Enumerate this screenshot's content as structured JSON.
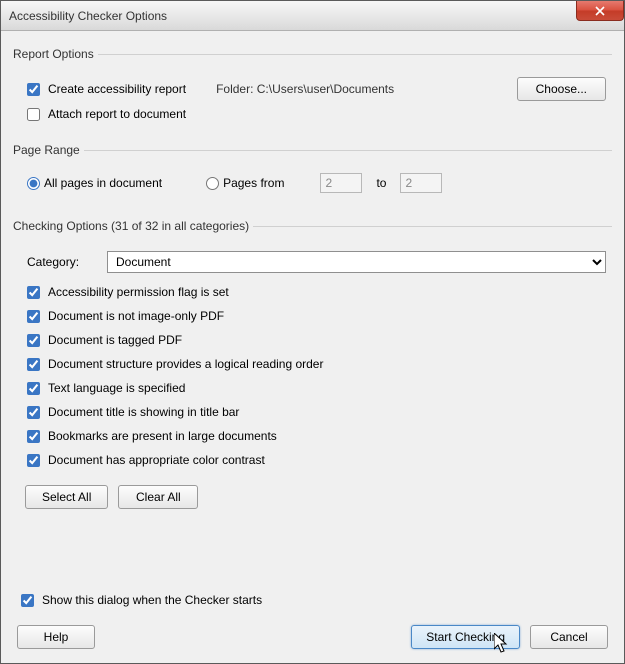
{
  "window": {
    "title": "Accessibility Checker Options"
  },
  "report": {
    "legend": "Report Options",
    "create_label": "Create accessibility report",
    "folder_prefix": "Folder:",
    "folder_path": "C:\\Users\\user\\Documents",
    "choose_label": "Choose...",
    "attach_label": "Attach report to document"
  },
  "page_range": {
    "legend": "Page Range",
    "all_label": "All pages in document",
    "from_label": "Pages from",
    "from_value": "2",
    "to_label": "to",
    "to_value": "2"
  },
  "checking": {
    "legend": "Checking Options (31 of 32 in all categories)",
    "category_label": "Category:",
    "category_value": "Document",
    "items": [
      "Accessibility permission flag is set",
      "Document is not image-only PDF",
      "Document is tagged PDF",
      "Document structure provides a logical reading order",
      "Text language is specified",
      "Document title is showing in title bar",
      "Bookmarks are present in large documents",
      "Document has appropriate color contrast"
    ],
    "select_all": "Select All",
    "clear_all": "Clear All"
  },
  "show_dialog_label": "Show this dialog when the Checker starts",
  "footer": {
    "help": "Help",
    "start": "Start Checking",
    "cancel": "Cancel"
  }
}
